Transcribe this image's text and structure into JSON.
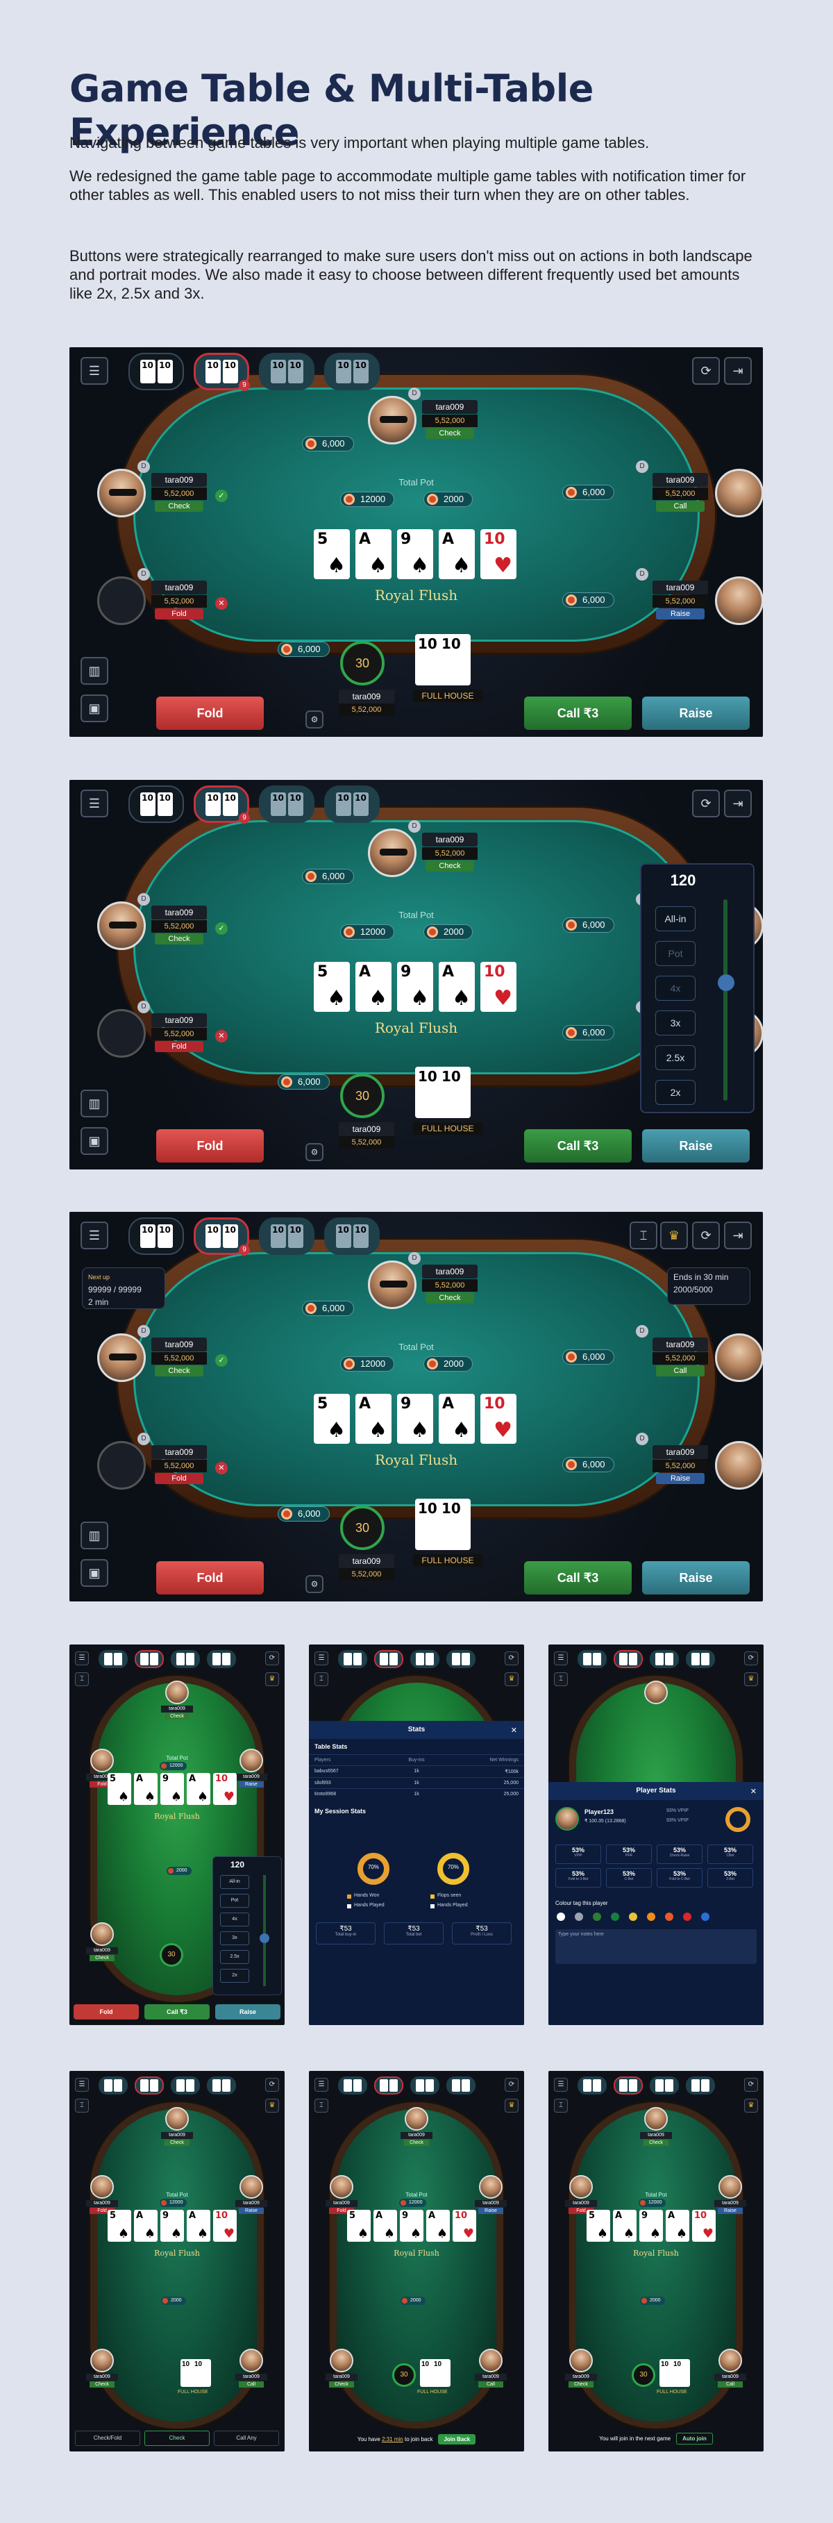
{
  "heading": "Game Table & Multi-Table Experience",
  "paragraphs": [
    "Navigating between game tables is very important when playing multiple game tables.",
    "We redesigned the game table page to accommodate multiple game tables with notification timer for other tables as well. This enabled users to not miss their turn when they are on other tables.",
    "Buttons were strategically rearranged to make sure users don't miss out on actions in both landscape and portrait modes. We also made it easy to choose between different frequently used bet amounts like 2x, 2.5x and 3x."
  ],
  "table": {
    "player_name": "tara009",
    "chips": "5,52,000",
    "bet_6000": "6,000",
    "pot_label": "Total Pot",
    "pot_main": "12000",
    "pot_side": "2000",
    "hand_name": "Royal Flush",
    "hero_hand": "FULL HOUSE",
    "timer": "30",
    "status": {
      "check": "Check",
      "call": "Call",
      "fold": "Fold",
      "raise": "Raise"
    },
    "dealer_mark": "D",
    "notif_badge": "9",
    "board_cards": [
      {
        "rank": "5",
        "suit": "♠",
        "color": "#000000"
      },
      {
        "rank": "A",
        "suit": "♠",
        "color": "#000000"
      },
      {
        "rank": "9",
        "suit": "♠",
        "color": "#000000"
      },
      {
        "rank": "A",
        "suit": "♠",
        "color": "#000000"
      },
      {
        "rank": "10",
        "suit": "♥",
        "color": "#d0202a"
      }
    ],
    "hero_cards": [
      {
        "rank": "10"
      },
      {
        "rank": "10"
      }
    ],
    "buttons": {
      "fold": "Fold",
      "call": "Call ₹3",
      "raise": "Raise"
    }
  },
  "bet_slider": {
    "value": "120",
    "options": [
      "All-in",
      "Pot",
      "4x",
      "3x",
      "2.5x",
      "2x"
    ]
  },
  "tournament": {
    "next_up": "Next up",
    "blinds": "99999 / 99999",
    "time": "2 min",
    "ends": "Ends in 30 min",
    "players": "2000/5000"
  },
  "stats_modal": {
    "title": "Stats",
    "table_stats": "Table Stats",
    "columns": [
      "Players",
      "Buy-ins",
      "Net Winnings"
    ],
    "rows": [
      [
        "babus6567",
        "1k",
        "₹100k"
      ],
      [
        "silol993",
        "1k",
        "25,000"
      ],
      [
        "tiroto9968",
        "1k",
        "25,000"
      ]
    ],
    "session_stats": "My Session Stats",
    "donut1": "70%",
    "donut2": "70%",
    "legend": [
      "Hands Won",
      "Flops seen",
      "Hands Played",
      "Hands Played"
    ],
    "totals": [
      {
        "value": "₹53",
        "label": "Total buy-in"
      },
      {
        "value": "₹53",
        "label": "Total bet"
      },
      {
        "value": "₹53",
        "label": "Profit / Loss"
      }
    ]
  },
  "player_stats": {
    "title": "Player Stats",
    "name": "Player123",
    "balance": "₹ 100.35 (13.2868)",
    "vpip1": "93% VPIP",
    "vpip2": "93% VPIP",
    "cells": [
      {
        "v": "53%",
        "l": "VPIP"
      },
      {
        "v": "53%",
        "l": "PFR"
      },
      {
        "v": "53%",
        "l": "Check-Raise"
      },
      {
        "v": "53%",
        "l": "CBet"
      },
      {
        "v": "53%",
        "l": "Fold to 3-Bet"
      },
      {
        "v": "53%",
        "l": "C-Bet"
      },
      {
        "v": "53%",
        "l": "Fold to C-Bet"
      },
      {
        "v": "53%",
        "l": "3-Bet"
      }
    ],
    "colour_tag": "Colour tag this player",
    "notes_placeholder": "Type your notes here",
    "tag_colors": [
      "#ffffff",
      "#9aa3b0",
      "#2e7d32",
      "#16803c",
      "#e8c23a",
      "#f08c1a",
      "#e85a2a",
      "#d8282a",
      "#2a6ed8"
    ]
  },
  "portrait": {
    "check_fold": "Check/Fold",
    "check": "Check",
    "call_any": "Call Any",
    "rejoin_prefix": "You have",
    "rejoin_time": "2:31 min",
    "rejoin_suffix": "to join back",
    "join_back": "Join Back",
    "next_game": "You will join in the next game",
    "auto_join": "Auto join"
  }
}
